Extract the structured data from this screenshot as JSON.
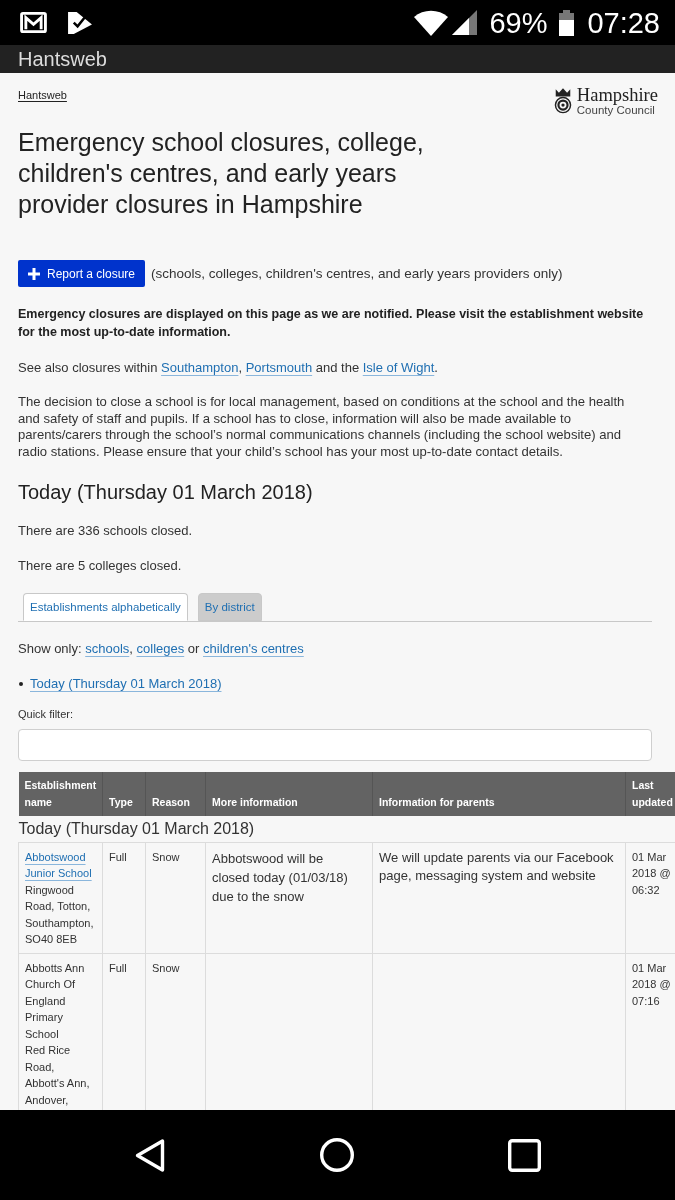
{
  "status_bar": {
    "battery": "69%",
    "time": "07:28"
  },
  "app_bar": {
    "title": "Hantsweb"
  },
  "breadcrumb": [
    "Hantsweb"
  ],
  "logo": {
    "title": "Hampshire",
    "subtitle": "County Council"
  },
  "page_title": "Emergency school closures, college, children's centres, and early years provider closures in Hampshire",
  "report": {
    "button": "Report a closure",
    "note": "(schools, colleges, children's centres, and early years providers only)"
  },
  "notice": "Emergency closures are displayed on this page as we are notified. Please visit the establishment website for the most up-to-date information.",
  "see_also": [
    {
      "kind": "text",
      "text": "See also closures within "
    },
    {
      "kind": "link",
      "text": "Southampton"
    },
    {
      "kind": "text",
      "text": ", "
    },
    {
      "kind": "link",
      "text": "Portsmouth"
    },
    {
      "kind": "text",
      "text": " and the "
    },
    {
      "kind": "link",
      "text": "Isle of Wight"
    },
    {
      "kind": "text",
      "text": "."
    }
  ],
  "decision_text": "The decision to close a school is for local management, based on conditions at the school and the health and safety of staff and pupils. If a school has to close, information will also be made available to parents/carers through the school’s normal communications channels (including the school website) and radio stations. Please ensure that your child’s school has your most up-to-date contact details.",
  "today_heading": "Today (Thursday 01 March 2018)",
  "closure_counts": [
    "There are 336 schools closed.",
    "There are 5 colleges closed."
  ],
  "tabs": [
    {
      "label": "Establishments alphabetically",
      "selected": true
    },
    {
      "label": "By district",
      "selected": false
    }
  ],
  "show_only": [
    {
      "kind": "text",
      "text": "Show only: "
    },
    {
      "kind": "link",
      "text": "schools"
    },
    {
      "kind": "text",
      "text": ", "
    },
    {
      "kind": "link",
      "text": "colleges"
    },
    {
      "kind": "text",
      "text": " or "
    },
    {
      "kind": "link",
      "text": "children's centres"
    }
  ],
  "date_links": [
    "Today (Thursday 01 March 2018)"
  ],
  "quick_filter": {
    "label": "Quick filter:"
  },
  "table": {
    "columns": [
      "Establishment name",
      "Type",
      "Reason",
      "More information",
      "Information for parents",
      "Last updated"
    ],
    "group": "Today (Thursday 01 March 2018)",
    "rows": [
      {
        "name": "Abbotswood Junior School",
        "is_link": true,
        "address": "Ringwood Road, Totton, Southampton, SO40 8EB",
        "type": "Full",
        "reason": "Snow",
        "more_information": "Abbotswood will be closed today (01/03/18) due to the snow",
        "information_for_parents": "We will update parents via our Facebook page, messaging system and website",
        "last_updated": "01 Mar 2018 @ 06:32"
      },
      {
        "name": "Abbotts Ann Church Of England Primary School",
        "is_link": false,
        "address": "Red Rice Road, Abbott's Ann, Andover,",
        "type": "Full",
        "reason": "Snow",
        "last_updated": "01 Mar 2018 @ 07:16"
      }
    ]
  }
}
